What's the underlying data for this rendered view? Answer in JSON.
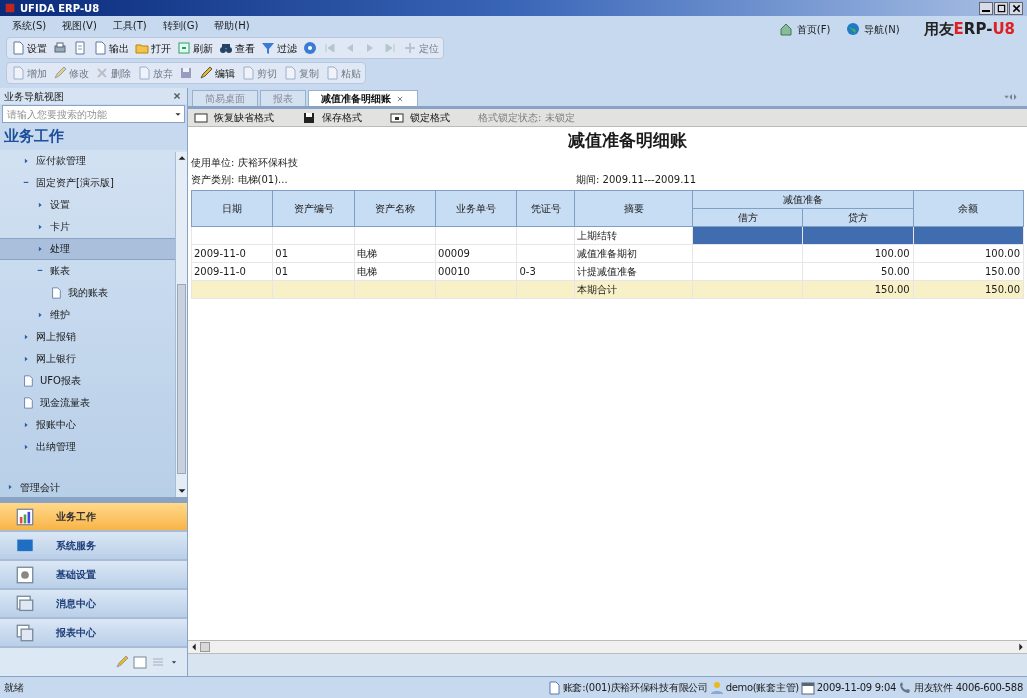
{
  "window": {
    "title": "UFIDA ERP-U8"
  },
  "menu": [
    "系统(S)",
    "视图(V)",
    "工具(T)",
    "转到(G)",
    "帮助(H)"
  ],
  "top_links": [
    {
      "label": "首页(F)",
      "kind": "home"
    },
    {
      "label": "导航(N)",
      "kind": "globe"
    }
  ],
  "brand": {
    "prefix": "用友",
    "accent": "E",
    "rest": "RP-",
    "tail": "U8"
  },
  "toolbar1": [
    {
      "label": "设置",
      "kind": "doc",
      "disabled": false
    },
    {
      "kind": "print",
      "disabled": false
    },
    {
      "kind": "preview",
      "disabled": false
    },
    {
      "label": "输出",
      "kind": "doc",
      "disabled": false
    },
    {
      "label": "打开",
      "kind": "folder",
      "disabled": false
    },
    {
      "label": "刷新",
      "kind": "refresh",
      "disabled": false
    },
    {
      "label": "查看",
      "kind": "binoculars",
      "disabled": false
    },
    {
      "label": "过滤",
      "kind": "filter",
      "disabled": false
    },
    {
      "kind": "help",
      "disabled": false
    },
    {
      "kind": "first",
      "disabled": true
    },
    {
      "kind": "prev",
      "disabled": true
    },
    {
      "kind": "next",
      "disabled": true
    },
    {
      "kind": "last",
      "disabled": true
    },
    {
      "label": "定位",
      "kind": "locate",
      "disabled": true
    }
  ],
  "toolbar2": [
    {
      "label": "增加",
      "kind": "doc",
      "disabled": true
    },
    {
      "label": "修改",
      "kind": "edit",
      "disabled": true
    },
    {
      "label": "删除",
      "kind": "delete",
      "disabled": true
    },
    {
      "label": "放弃",
      "kind": "doc",
      "disabled": true
    },
    {
      "kind": "save",
      "disabled": true
    },
    {
      "label": "编辑",
      "kind": "edit",
      "disabled": false
    },
    {
      "label": "剪切",
      "kind": "doc",
      "disabled": true
    },
    {
      "label": "复制",
      "kind": "doc",
      "disabled": true
    },
    {
      "label": "粘贴",
      "kind": "doc",
      "disabled": true
    }
  ],
  "sidebar": {
    "title": "业务导航视图",
    "search": {
      "placeholder": "请输入您要搜索的功能"
    },
    "heading": "业务工作",
    "tree": [
      {
        "label": "应付款管理",
        "kind": "folder",
        "expanded": false,
        "selected": false
      },
      {
        "label": "固定资产[演示版]",
        "kind": "folder",
        "expanded": true,
        "selected": false,
        "children": [
          {
            "label": "设置",
            "kind": "folder",
            "expanded": false,
            "selected": false
          },
          {
            "label": "卡片",
            "kind": "folder",
            "expanded": false,
            "selected": false
          },
          {
            "label": "处理",
            "kind": "folder",
            "expanded": false,
            "selected": true
          },
          {
            "label": "账表",
            "kind": "folder",
            "expanded": true,
            "selected": false,
            "children": [
              {
                "label": "我的账表",
                "kind": "page",
                "selected": false
              }
            ]
          },
          {
            "label": "维护",
            "kind": "folder",
            "expanded": false,
            "selected": false
          }
        ]
      },
      {
        "label": "网上报销",
        "kind": "folder",
        "expanded": false,
        "selected": false
      },
      {
        "label": "网上银行",
        "kind": "folder",
        "expanded": false,
        "selected": false
      },
      {
        "label": "UFO报表",
        "kind": "page",
        "selected": false
      },
      {
        "label": "现金流量表",
        "kind": "page",
        "selected": false
      },
      {
        "label": "报账中心",
        "kind": "folder",
        "expanded": false,
        "selected": false
      },
      {
        "label": "出纳管理",
        "kind": "folder",
        "expanded": false,
        "selected": false
      }
    ],
    "section": "管理会计",
    "modules": [
      {
        "label": "业务工作",
        "selected": true
      },
      {
        "label": "系统服务",
        "selected": false
      },
      {
        "label": "基础设置",
        "selected": false
      },
      {
        "label": "消息中心",
        "selected": false
      },
      {
        "label": "报表中心",
        "selected": false
      }
    ]
  },
  "tabs": [
    {
      "label": "简易桌面",
      "selected": false,
      "closable": false
    },
    {
      "label": "报表",
      "selected": false,
      "closable": false
    },
    {
      "label": "减值准备明细账",
      "selected": true,
      "closable": true
    }
  ],
  "report_toolbar": [
    {
      "label": "恢复缺省格式",
      "disabled": false
    },
    {
      "label": "保存格式",
      "disabled": false
    },
    {
      "label": "锁定格式",
      "disabled": false
    },
    {
      "label": "格式锁定状态: 未锁定",
      "disabled": true
    }
  ],
  "report": {
    "title": "减值准备明细账",
    "unit": "使用单位: 庆裕环保科技",
    "category": "资产类别: 电梯(01)...",
    "period": "期间: 2009.11---2009.11",
    "columns": [
      "日期",
      "资产编号",
      "资产名称",
      "业务单号",
      "凭证号",
      "摘要"
    ],
    "group": "减值准备",
    "subcolumns": [
      "借方",
      "贷方"
    ],
    "last_column": "余额",
    "rows": [
      {
        "kind": "carry",
        "cells": [
          "",
          "",
          "",
          "",
          "",
          "上期结转",
          "",
          "",
          ""
        ]
      },
      {
        "kind": "normal",
        "cells": [
          "2009-11-0",
          "01",
          "电梯",
          "00009",
          "",
          "减值准备期初",
          "",
          "100.00",
          "100.00"
        ]
      },
      {
        "kind": "normal",
        "cells": [
          "2009-11-0",
          "01",
          "电梯",
          "00010",
          "0-3",
          "计提减值准备",
          "",
          "50.00",
          "150.00"
        ]
      },
      {
        "kind": "total",
        "cells": [
          "",
          "",
          "",
          "",
          "",
          "本期合计",
          "",
          "150.00",
          "150.00"
        ]
      }
    ]
  },
  "status_bar": {
    "left": "就绪",
    "items": [
      {
        "text": "账套:(001)庆裕环保科技有限公司",
        "kind": "doc"
      },
      {
        "text": "demo(账套主管)",
        "kind": "user"
      },
      {
        "text": "2009-11-09 9:04",
        "kind": "calendar"
      },
      {
        "text": "用友软件 4006-600-588",
        "kind": "phone"
      }
    ]
  }
}
